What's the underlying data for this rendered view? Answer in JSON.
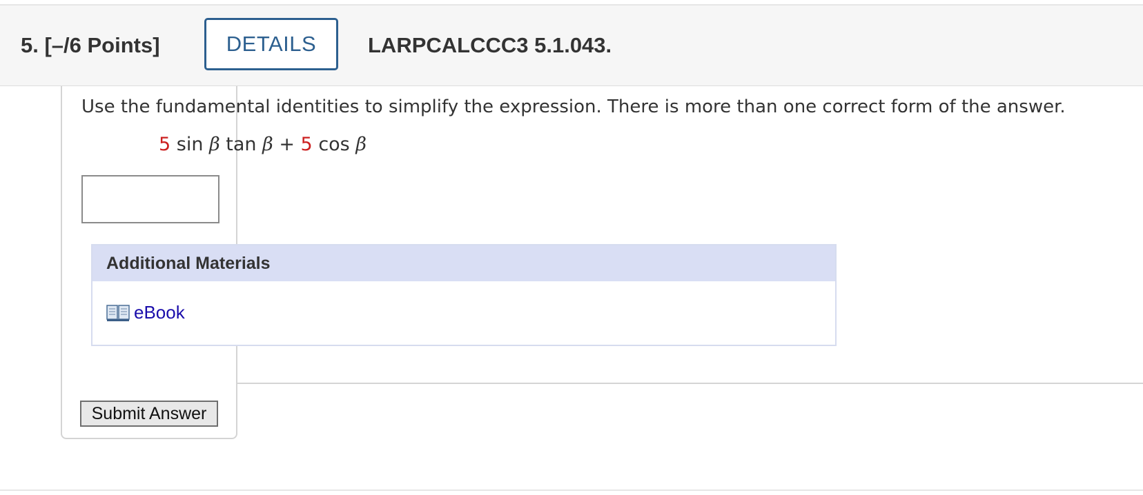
{
  "question": {
    "number_points": "5. [–/6 Points]",
    "details_label": "DETAILS",
    "problem_id": "LARPCALCCC3 5.1.043.",
    "instructions": "Use the fundamental identities to simplify the expression. There is more than one correct form of the answer.",
    "expression": {
      "coef1": "5",
      "fn1": "sin",
      "var1": "β",
      "fn2": "tan",
      "var2": "β",
      "operator": "+",
      "coef2": "5",
      "fn3": "cos",
      "var3": "β"
    },
    "answer_value": ""
  },
  "materials": {
    "title": "Additional Materials",
    "ebook_label": "eBook",
    "ebook_icon": "book-icon"
  },
  "submit_label": "Submit Answer",
  "colors": {
    "details_border": "#2c5f8f",
    "coefficient": "#cc1f1f",
    "materials_header_bg": "#d9def4",
    "link": "#1a0dab"
  }
}
